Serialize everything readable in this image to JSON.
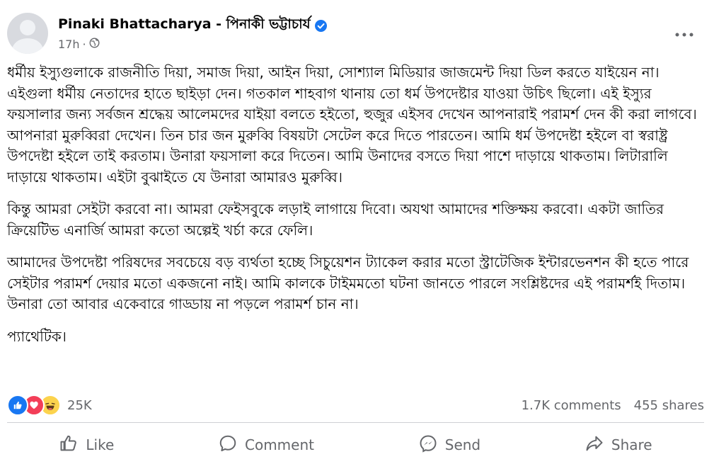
{
  "post": {
    "author": "Pinaki Bhattacharya - পিনাকী ভট্টাচার্য",
    "verified_icon": "verified-badge-icon",
    "time": "17h",
    "separator": "·",
    "audience_icon": "globe-icon",
    "paragraphs": [
      "ধর্মীয় ইস্যুগুলাকে রাজনীতি দিয়া, সমাজ দিয়া, আইন দিয়া, সোশ্যাল মিডিয়ার জাজমেন্ট দিয়া ডিল করতে যাইয়েন না। এইগুলা ধর্মীয় নেতাদের হাতে ছাইড়া দেন। গতকাল শাহবাগ থানায় তো ধর্ম উপদেষ্টার যাওয়া উচিৎ ছিলো। এই ইস্যুর ফয়সালার জন্য সর্বজন শ্রদ্ধেয় আলেমদের যাইয়া বলতে হইতো, হুজুর এইসব দেখেন আপনারাই পরামর্শ দেন কী করা লাগবে। আপনারা মুরুব্বিরা দেখেন। তিন চার জন মুরুব্বি বিষয়টা সেটেল করে দিতে পারতেন। আমি ধর্ম উপদেষ্টা হইলে বা স্বরাষ্ট্র উপদেষ্টা হইলে তাই করতাম। উনারা ফয়সালা করে দিতেন। আমি উনাদের বসতে দিয়া পাশে দাড়ায়ে থাকতাম। লিটারালি দাড়ায়ে থাকতাম। এইটা বুঝাইতে যে উনারা আমারও মুরুব্বি।",
      "কিন্তু আমরা সেইটা করবো না। আমরা ফেইসবুকে লড়াই লাগায়ে দিবো। অযথা আমাদের শক্তিক্ষয় করবো। একটা জাতির ক্রিয়েটিভ এনার্জি আমরা কতো অল্পেই খর্চা করে ফেলি।",
      "আমাদের উপদেষ্টা পরিষদের সবচেয়ে বড় ব্যর্থতা হচ্ছে সিচুয়েশন ট্যাকেল করার মতো স্ট্রাটেজিক ইন্টারভেনশন কী হতে পারে সেইটার পরামর্শ দেয়ার মতো একজনো নাই। আমি কালকে টাইমমতো ঘটনা জানতে পারলে সংশ্লিষ্টদের এই পরামর্শই দিতাম। উনারা তো আবার একেবারে গাড্ডায় না পড়লে পরামর্শ চান না।",
      "প্যাথেটিক।"
    ]
  },
  "stats": {
    "reactions_count": "25K",
    "reaction_icons": [
      "like-reaction-icon",
      "love-reaction-icon",
      "haha-reaction-icon"
    ],
    "comments": "1.7K comments",
    "shares": "455 shares"
  },
  "actions": {
    "like": "Like",
    "comment": "Comment",
    "send": "Send",
    "share": "Share"
  },
  "colors": {
    "text": "#050505",
    "secondary": "#65676b",
    "facebook_blue": "#1877f2",
    "love_red": "#f33e58",
    "haha_yellow": "#fcd34d"
  }
}
